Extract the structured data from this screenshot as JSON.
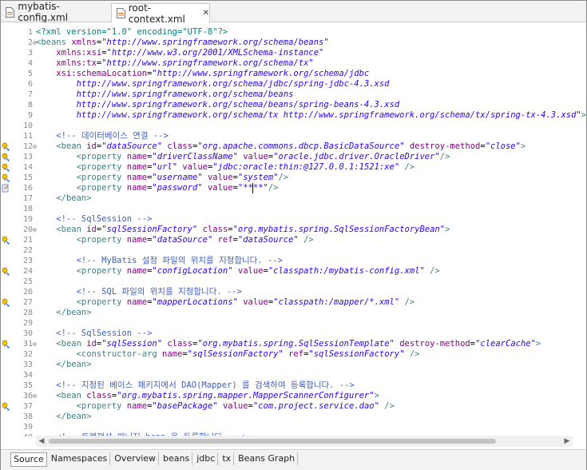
{
  "editor_tabs": [
    {
      "label": "mybatis-config.xml",
      "active": false
    },
    {
      "label": "root-context.xml",
      "active": true
    }
  ],
  "editor_tab_close": "✕",
  "lines": [
    {
      "n": "1",
      "fold": "",
      "marker": "",
      "tokens": [
        [
          "pi",
          "<?xml version=\"1.0\" encoding=\"UTF-8\"?>"
        ]
      ]
    },
    {
      "n": "2",
      "fold": "⊖",
      "marker": "",
      "tokens": [
        [
          "tag",
          "<beans "
        ],
        [
          "attr",
          "xmlns"
        ],
        [
          "plain",
          "="
        ],
        [
          "str",
          "\"http://www.springframework.org/schema/beans\""
        ]
      ]
    },
    {
      "n": "3",
      "fold": "",
      "marker": "",
      "tokens": [
        [
          "plain",
          "    "
        ],
        [
          "attr",
          "xmlns:xsi"
        ],
        [
          "plain",
          "="
        ],
        [
          "str",
          "\"http://www.w3.org/2001/XMLSchema-instance\""
        ]
      ]
    },
    {
      "n": "4",
      "fold": "",
      "marker": "",
      "tokens": [
        [
          "plain",
          "    "
        ],
        [
          "attr",
          "xmlns:tx"
        ],
        [
          "plain",
          "="
        ],
        [
          "str",
          "\"http://www.springframework.org/schema/tx\""
        ]
      ]
    },
    {
      "n": "5",
      "fold": "",
      "marker": "",
      "tokens": [
        [
          "plain",
          "    "
        ],
        [
          "attr",
          "xsi:schemaLocation"
        ],
        [
          "plain",
          "="
        ],
        [
          "str",
          "\"http://www.springframework.org/schema/jdbc"
        ]
      ]
    },
    {
      "n": "6",
      "fold": "",
      "marker": "",
      "tokens": [
        [
          "str",
          "        http://www.springframework.org/schema/jdbc/spring-jdbc-4.3.xsd"
        ]
      ]
    },
    {
      "n": "7",
      "fold": "",
      "marker": "",
      "tokens": [
        [
          "str",
          "        http://www.springframework.org/schema/beans"
        ]
      ]
    },
    {
      "n": "8",
      "fold": "",
      "marker": "",
      "tokens": [
        [
          "str",
          "        http://www.springframework.org/schema/beans/spring-beans-4.3.xsd"
        ]
      ]
    },
    {
      "n": "9",
      "fold": "",
      "marker": "",
      "tokens": [
        [
          "str",
          "        http://www.springframework.org/schema/tx http://www.springframework.org/schema/tx/spring-tx-4.3.xsd\""
        ],
        [
          "tag",
          ">"
        ]
      ]
    },
    {
      "n": "10",
      "fold": "",
      "marker": "",
      "tokens": []
    },
    {
      "n": "11",
      "fold": "",
      "marker": "",
      "tokens": [
        [
          "cmt",
          "    <!-- 데이터베이스 연결 -->"
        ]
      ]
    },
    {
      "n": "12",
      "fold": "⊖",
      "marker": "bulb",
      "tokens": [
        [
          "plain",
          "    "
        ],
        [
          "tag",
          "<bean "
        ],
        [
          "attr",
          "id"
        ],
        [
          "plain",
          "="
        ],
        [
          "str",
          "\"dataSource\""
        ],
        [
          "plain",
          " "
        ],
        [
          "attr",
          "class"
        ],
        [
          "plain",
          "="
        ],
        [
          "str",
          "\"org.apache.commons.dbcp.BasicDataSource\""
        ],
        [
          "plain",
          " "
        ],
        [
          "attr",
          "destroy-method"
        ],
        [
          "plain",
          "="
        ],
        [
          "str",
          "\"close\""
        ],
        [
          "tag",
          ">"
        ]
      ]
    },
    {
      "n": "13",
      "fold": "",
      "marker": "bulb",
      "tokens": [
        [
          "plain",
          "        "
        ],
        [
          "tag",
          "<property "
        ],
        [
          "attr",
          "name"
        ],
        [
          "plain",
          "="
        ],
        [
          "str",
          "\"driverClassName\""
        ],
        [
          "plain",
          " "
        ],
        [
          "attr",
          "value"
        ],
        [
          "plain",
          "="
        ],
        [
          "str",
          "\"oracle.jdbc.driver.OracleDriver\""
        ],
        [
          "tag",
          "/>"
        ]
      ]
    },
    {
      "n": "14",
      "fold": "",
      "marker": "bulb",
      "tokens": [
        [
          "plain",
          "        "
        ],
        [
          "tag",
          "<property "
        ],
        [
          "attr",
          "name"
        ],
        [
          "plain",
          "="
        ],
        [
          "str",
          "\"url\""
        ],
        [
          "plain",
          " "
        ],
        [
          "attr",
          "value"
        ],
        [
          "plain",
          "="
        ],
        [
          "str",
          "\"jdbc:oracle:thin:@127.0.0.1:1521:xe\""
        ],
        [
          "plain",
          " "
        ],
        [
          "tag",
          "/>"
        ]
      ]
    },
    {
      "n": "15",
      "fold": "",
      "marker": "bulb",
      "tokens": [
        [
          "plain",
          "        "
        ],
        [
          "tag",
          "<property "
        ],
        [
          "attr",
          "name"
        ],
        [
          "plain",
          "="
        ],
        [
          "str",
          "\"username\""
        ],
        [
          "plain",
          " "
        ],
        [
          "attr",
          "value"
        ],
        [
          "plain",
          "="
        ],
        [
          "str",
          "\"system\""
        ],
        [
          "tag",
          "/>"
        ]
      ]
    },
    {
      "n": "16",
      "fold": "",
      "marker": "edit",
      "tokens": [
        [
          "plain",
          "        "
        ],
        [
          "tag",
          "<property "
        ],
        [
          "attr",
          "name"
        ],
        [
          "plain",
          "="
        ],
        [
          "str",
          "\"password\""
        ],
        [
          "plain",
          " "
        ],
        [
          "attr",
          "value"
        ],
        [
          "plain",
          "="
        ],
        [
          "str",
          "\"****\""
        ],
        [
          "tag",
          "/>"
        ]
      ]
    },
    {
      "n": "17",
      "fold": "",
      "marker": "",
      "tokens": [
        [
          "plain",
          "    "
        ],
        [
          "tag",
          "</bean>"
        ]
      ]
    },
    {
      "n": "18",
      "fold": "",
      "marker": "",
      "tokens": []
    },
    {
      "n": "19",
      "fold": "",
      "marker": "",
      "tokens": [
        [
          "cmt",
          "    <!-- SqlSession -->"
        ]
      ]
    },
    {
      "n": "20",
      "fold": "⊖",
      "marker": "",
      "tokens": [
        [
          "plain",
          "    "
        ],
        [
          "tag",
          "<bean "
        ],
        [
          "attr",
          "id"
        ],
        [
          "plain",
          "="
        ],
        [
          "str",
          "\"sqlSessionFactory\""
        ],
        [
          "plain",
          " "
        ],
        [
          "attr",
          "class"
        ],
        [
          "plain",
          "="
        ],
        [
          "str",
          "\"org.mybatis.spring.SqlSessionFactoryBean\""
        ],
        [
          "tag",
          ">"
        ]
      ]
    },
    {
      "n": "21",
      "fold": "",
      "marker": "bulb",
      "tokens": [
        [
          "plain",
          "        "
        ],
        [
          "tag",
          "<property "
        ],
        [
          "attr",
          "name"
        ],
        [
          "plain",
          "="
        ],
        [
          "str",
          "\"dataSource\""
        ],
        [
          "plain",
          " "
        ],
        [
          "attr",
          "ref"
        ],
        [
          "plain",
          "="
        ],
        [
          "str",
          "\"dataSource\""
        ],
        [
          "plain",
          " "
        ],
        [
          "tag",
          "/>"
        ]
      ]
    },
    {
      "n": "22",
      "fold": "",
      "marker": "",
      "tokens": []
    },
    {
      "n": "23",
      "fold": "",
      "marker": "",
      "tokens": [
        [
          "cmt",
          "        <!-- MyBatis 설정 파일의 위치를 지정합니다. -->"
        ]
      ]
    },
    {
      "n": "24",
      "fold": "",
      "marker": "bulb",
      "tokens": [
        [
          "plain",
          "        "
        ],
        [
          "tag",
          "<property "
        ],
        [
          "attr",
          "name"
        ],
        [
          "plain",
          "="
        ],
        [
          "str",
          "\"configLocation\""
        ],
        [
          "plain",
          " "
        ],
        [
          "attr",
          "value"
        ],
        [
          "plain",
          "="
        ],
        [
          "str",
          "\"classpath:/mybatis-config.xml\""
        ],
        [
          "plain",
          " "
        ],
        [
          "tag",
          "/>"
        ]
      ]
    },
    {
      "n": "25",
      "fold": "",
      "marker": "",
      "tokens": []
    },
    {
      "n": "26",
      "fold": "",
      "marker": "",
      "tokens": [
        [
          "cmt",
          "        <!-- SQL 파일의 위치를 지정합니다. -->"
        ]
      ]
    },
    {
      "n": "27",
      "fold": "",
      "marker": "bulb",
      "tokens": [
        [
          "plain",
          "        "
        ],
        [
          "tag",
          "<property "
        ],
        [
          "attr",
          "name"
        ],
        [
          "plain",
          "="
        ],
        [
          "str",
          "\"mapperLocations\""
        ],
        [
          "plain",
          " "
        ],
        [
          "attr",
          "value"
        ],
        [
          "plain",
          "="
        ],
        [
          "str",
          "\"classpath:/mapper/*.xml\""
        ],
        [
          "plain",
          " "
        ],
        [
          "tag",
          "/>"
        ]
      ]
    },
    {
      "n": "28",
      "fold": "",
      "marker": "",
      "tokens": [
        [
          "plain",
          "    "
        ],
        [
          "tag",
          "</bean>"
        ]
      ]
    },
    {
      "n": "29",
      "fold": "",
      "marker": "",
      "tokens": []
    },
    {
      "n": "30",
      "fold": "",
      "marker": "",
      "tokens": [
        [
          "cmt",
          "    <!-- SqlSession -->"
        ]
      ]
    },
    {
      "n": "31",
      "fold": "⊖",
      "marker": "bulb",
      "tokens": [
        [
          "plain",
          "    "
        ],
        [
          "tag",
          "<bean "
        ],
        [
          "attr",
          "id"
        ],
        [
          "plain",
          "="
        ],
        [
          "str",
          "\"sqlSession\""
        ],
        [
          "plain",
          " "
        ],
        [
          "attr",
          "class"
        ],
        [
          "plain",
          "="
        ],
        [
          "str",
          "\"org.mybatis.spring.SqlSessionTemplate\""
        ],
        [
          "plain",
          " "
        ],
        [
          "attr",
          "destroy-method"
        ],
        [
          "plain",
          "="
        ],
        [
          "str",
          "\"clearCache\""
        ],
        [
          "tag",
          ">"
        ]
      ]
    },
    {
      "n": "32",
      "fold": "",
      "marker": "",
      "tokens": [
        [
          "plain",
          "        "
        ],
        [
          "tag",
          "<constructor-arg "
        ],
        [
          "attr",
          "name"
        ],
        [
          "plain",
          "="
        ],
        [
          "str",
          "\"sqlSessionFactory\""
        ],
        [
          "plain",
          " "
        ],
        [
          "attr",
          "ref"
        ],
        [
          "plain",
          "="
        ],
        [
          "str",
          "\"sqlSessionFactory\""
        ],
        [
          "plain",
          " "
        ],
        [
          "tag",
          "/>"
        ]
      ]
    },
    {
      "n": "33",
      "fold": "",
      "marker": "",
      "tokens": [
        [
          "plain",
          "    "
        ],
        [
          "tag",
          "</bean>"
        ]
      ]
    },
    {
      "n": "34",
      "fold": "",
      "marker": "",
      "tokens": []
    },
    {
      "n": "35",
      "fold": "",
      "marker": "",
      "tokens": [
        [
          "cmt",
          "    <!-- 지정된 베이스 패키지에서 DAO(Mapper) 를 검색하여 등록합니다. -->"
        ]
      ]
    },
    {
      "n": "36",
      "fold": "⊖",
      "marker": "",
      "tokens": [
        [
          "plain",
          "    "
        ],
        [
          "tag",
          "<bean "
        ],
        [
          "attr",
          "class"
        ],
        [
          "plain",
          "="
        ],
        [
          "str",
          "\"org.mybatis.spring.mapper.MapperScannerConfigurer\""
        ],
        [
          "tag",
          ">"
        ]
      ]
    },
    {
      "n": "37",
      "fold": "",
      "marker": "bulb",
      "tokens": [
        [
          "plain",
          "        "
        ],
        [
          "tag",
          "<property "
        ],
        [
          "attr",
          "name"
        ],
        [
          "plain",
          "="
        ],
        [
          "str",
          "\"basePackage\""
        ],
        [
          "plain",
          " "
        ],
        [
          "attr",
          "value"
        ],
        [
          "plain",
          "="
        ],
        [
          "str",
          "\"com.project.service.dao\""
        ],
        [
          "plain",
          " "
        ],
        [
          "tag",
          "/>"
        ]
      ]
    },
    {
      "n": "38",
      "fold": "",
      "marker": "",
      "tokens": [
        [
          "plain",
          "    "
        ],
        [
          "tag",
          "</bean>"
        ]
      ]
    },
    {
      "n": "39",
      "fold": "",
      "marker": "",
      "tokens": []
    },
    {
      "n": "40",
      "fold": "",
      "marker": "",
      "tokens": [
        [
          "cmt",
          "    <!-- 트랜잭션 매니저 bean 을 등록합니다. -->"
        ]
      ]
    }
  ],
  "hscroll": {
    "left_arrow": "◀",
    "right_arrow": "▶"
  },
  "bottom_tabs": [
    {
      "label": "Source",
      "active": true
    },
    {
      "label": "Namespaces",
      "active": false
    },
    {
      "label": "Overview",
      "active": false
    },
    {
      "label": "beans",
      "active": false
    },
    {
      "label": "jdbc",
      "active": false
    },
    {
      "label": "tx",
      "active": false
    },
    {
      "label": "Beans Graph",
      "active": false
    }
  ],
  "colors": {
    "tag": "#3f7f7f",
    "attr": "#7f007f",
    "string": "#2a00ff",
    "comment": "#3f5fbf",
    "line_number": "#8a8a8a"
  }
}
